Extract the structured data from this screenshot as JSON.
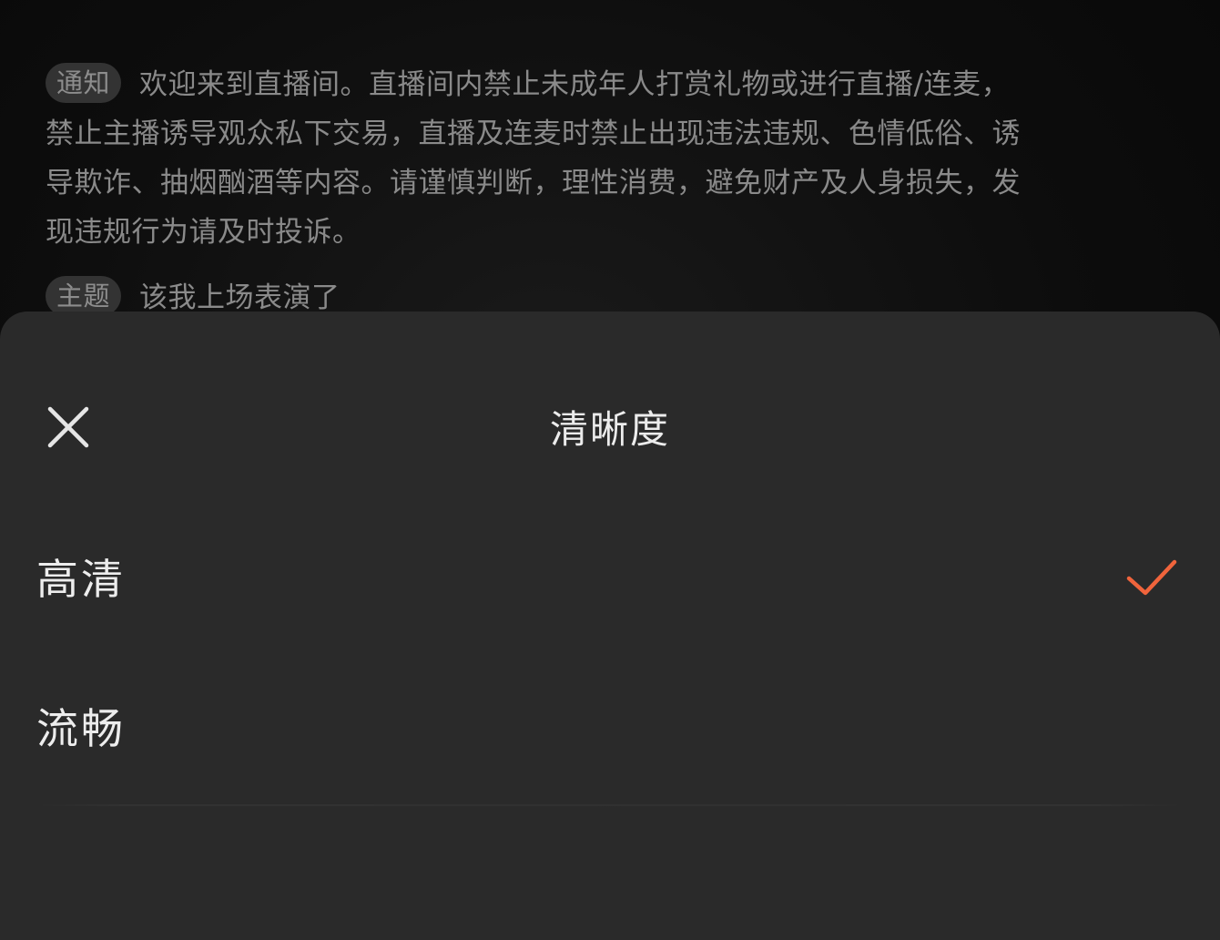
{
  "chat": {
    "notice": {
      "tag": "通知",
      "text": "欢迎来到直播间。直播间内禁止未成年人打赏礼物或进行直播/连麦，禁止主播诱导观众私下交易，直播及连麦时禁止出现违法违规、色情低俗、诱导欺诈、抽烟酗酒等内容。请谨慎判断，理性消费，避免财产及人身损失，发现违规行为请及时投诉。"
    },
    "topic": {
      "tag": "主题",
      "text": "该我上场表演了"
    }
  },
  "sheet": {
    "title": "清晰度",
    "close_icon": "close-icon",
    "options": [
      {
        "label": "高清",
        "selected": true
      },
      {
        "label": "流畅",
        "selected": false
      }
    ],
    "check_icon": "checkmark-icon",
    "accent_color": "#f0643c"
  }
}
